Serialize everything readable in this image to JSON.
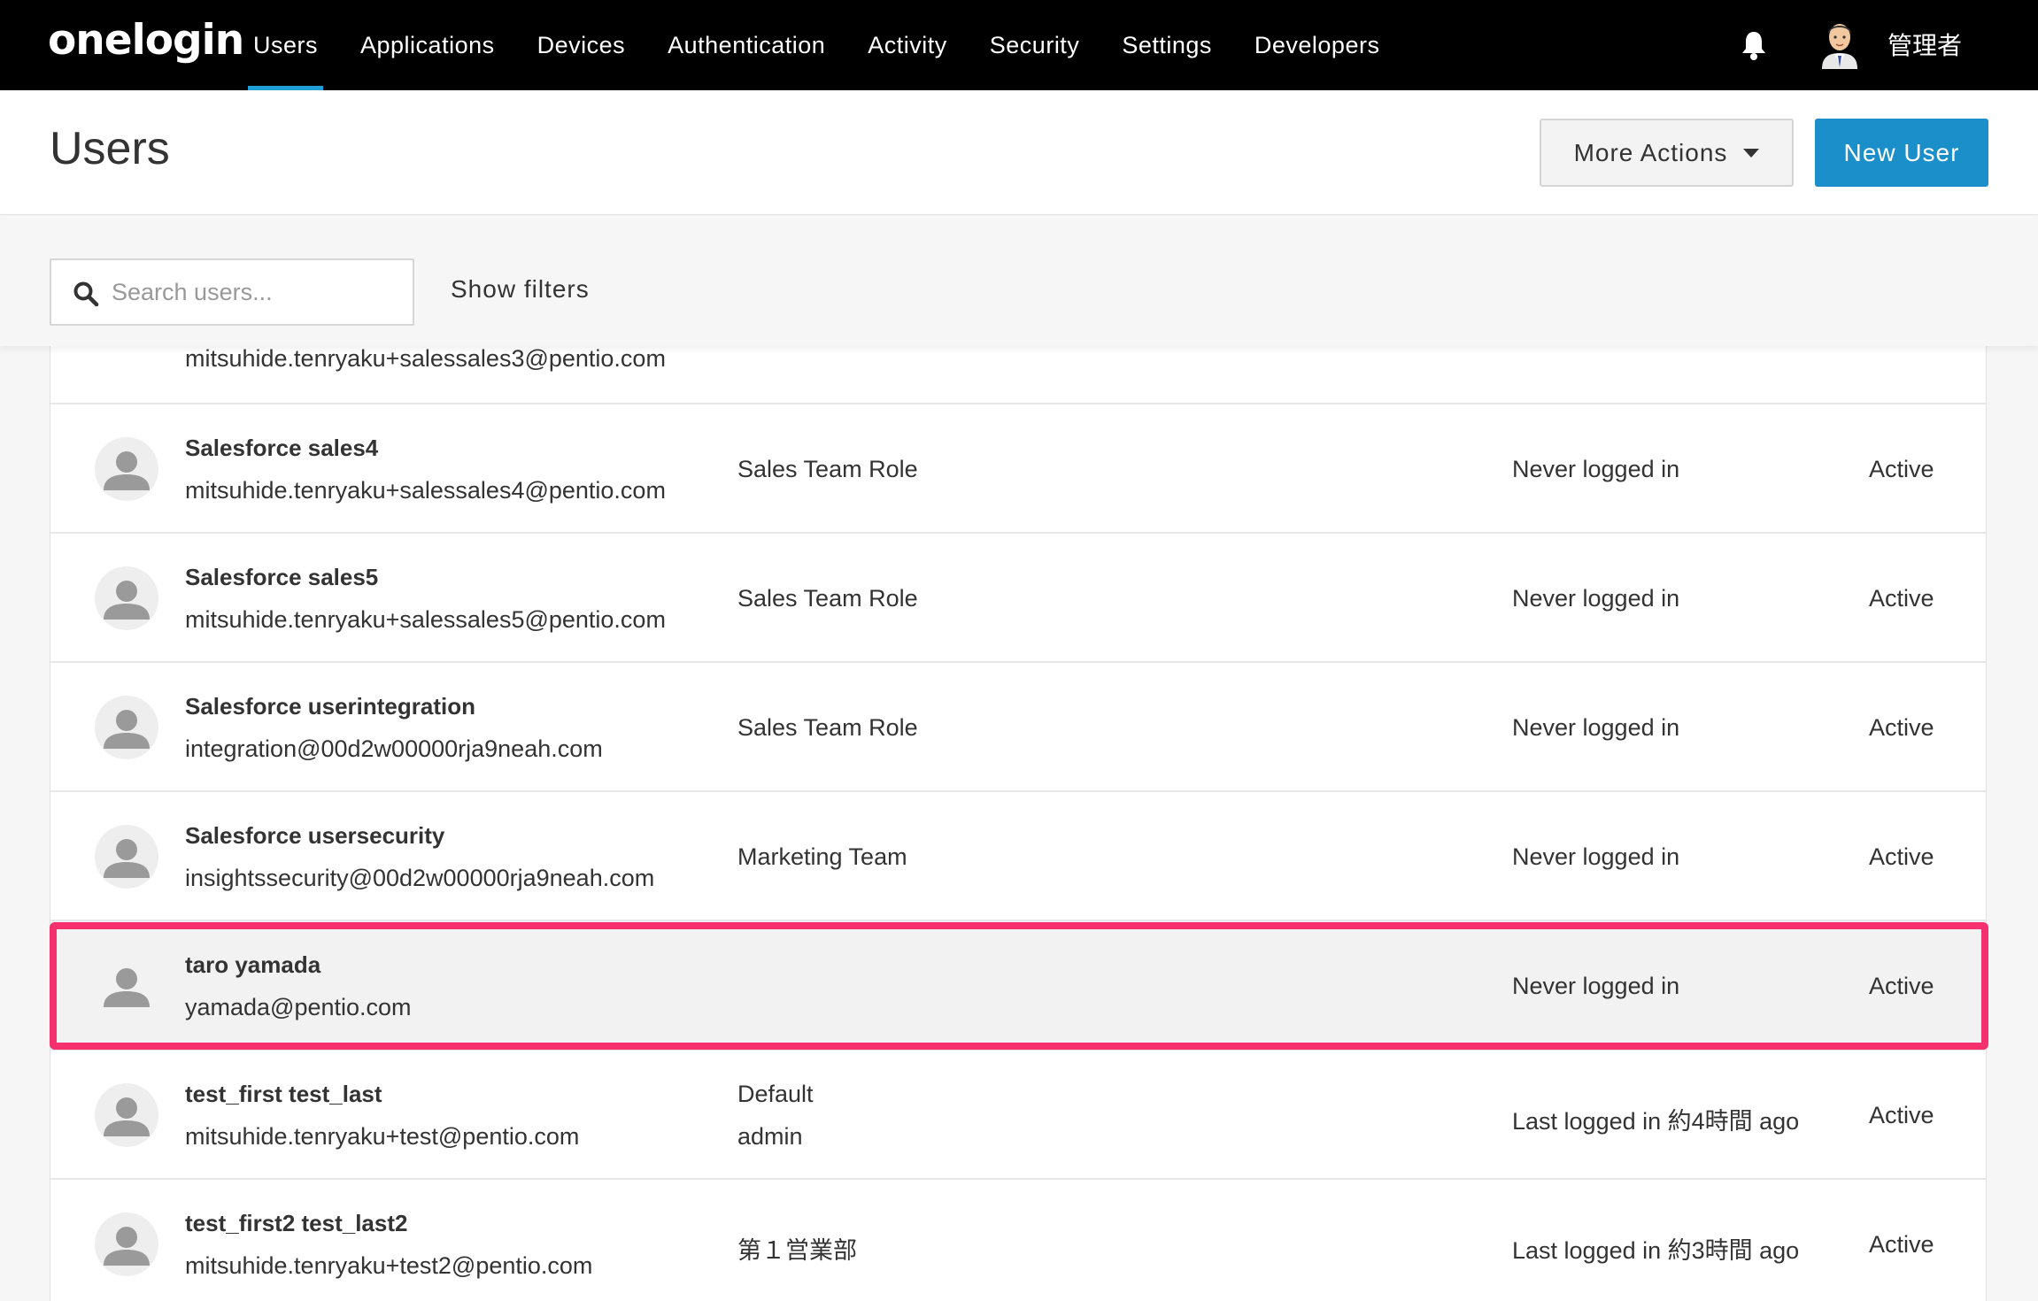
{
  "nav": {
    "logo": "onelogin",
    "items": [
      {
        "label": "Users",
        "active": true
      },
      {
        "label": "Applications",
        "active": false
      },
      {
        "label": "Devices",
        "active": false
      },
      {
        "label": "Authentication",
        "active": false
      },
      {
        "label": "Activity",
        "active": false
      },
      {
        "label": "Security",
        "active": false
      },
      {
        "label": "Settings",
        "active": false
      },
      {
        "label": "Developers",
        "active": false
      }
    ],
    "admin_name": "管理者"
  },
  "header": {
    "title": "Users",
    "more_actions_label": "More Actions",
    "new_user_label": "New User"
  },
  "search": {
    "placeholder": "Search users...",
    "show_filters_label": "Show filters"
  },
  "users": [
    {
      "name": "",
      "email": "mitsuhide.tenryaku+salessales3@pentio.com",
      "roles": [],
      "login": "",
      "status": ""
    },
    {
      "name": "Salesforce sales4",
      "email": "mitsuhide.tenryaku+salessales4@pentio.com",
      "roles": [
        "Sales Team Role"
      ],
      "login": "Never logged in",
      "status": "Active"
    },
    {
      "name": "Salesforce sales5",
      "email": "mitsuhide.tenryaku+salessales5@pentio.com",
      "roles": [
        "Sales Team Role"
      ],
      "login": "Never logged in",
      "status": "Active"
    },
    {
      "name": "Salesforce userintegration",
      "email": "integration@00d2w00000rja9neah.com",
      "roles": [
        "Sales Team Role"
      ],
      "login": "Never logged in",
      "status": "Active"
    },
    {
      "name": "Salesforce usersecurity",
      "email": "insightssecurity@00d2w00000rja9neah.com",
      "roles": [
        "Marketing Team"
      ],
      "login": "Never logged in",
      "status": "Active"
    },
    {
      "name": "taro yamada",
      "email": "yamada@pentio.com",
      "roles": [],
      "login": "Never logged in",
      "status": "Active"
    },
    {
      "name": "test_first test_last",
      "email": "mitsuhide.tenryaku+test@pentio.com",
      "roles": [
        "Default",
        "admin"
      ],
      "login": "Last logged in 約4時間 ago",
      "status": "Active"
    },
    {
      "name": "test_first2 test_last2",
      "email": "mitsuhide.tenryaku+test2@pentio.com",
      "roles": [
        "第１営業部"
      ],
      "login": "Last logged in 約3時間 ago",
      "status": "Active"
    }
  ],
  "colors": {
    "nav_bg": "#000000",
    "accent": "#1a8fc9",
    "highlight": "#f4306e"
  }
}
